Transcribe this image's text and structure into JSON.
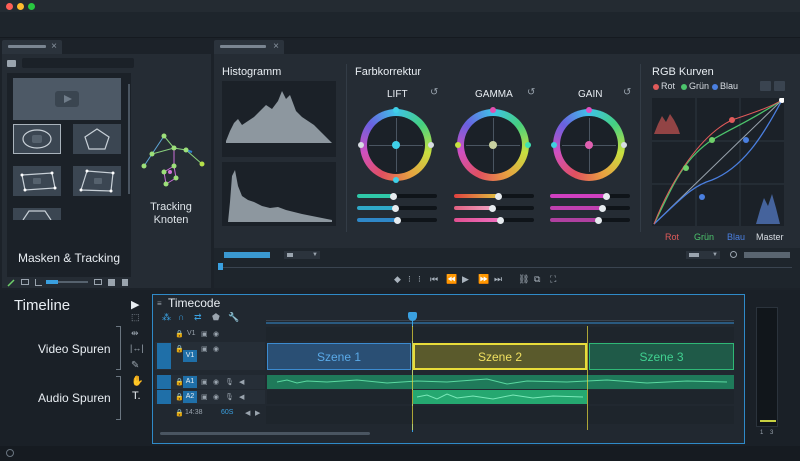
{
  "window": {
    "traffic_lights": [
      "#ff5f57",
      "#febc2e",
      "#28c840"
    ]
  },
  "left_panel": {
    "tab_close": "×",
    "label": "Masken & Tracking"
  },
  "tracking": {
    "label_line1": "Tracking",
    "label_line2": "Knoten"
  },
  "histogram": {
    "title": "Histogramm"
  },
  "color_correction": {
    "title": "Farbkorrektur",
    "wheels": [
      {
        "label": "LIFT",
        "reset_icon": "↺"
      },
      {
        "label": "GAMMA",
        "reset_icon": "↺"
      },
      {
        "label": "GAIN",
        "reset_icon": "↺"
      }
    ]
  },
  "rgb_curves": {
    "title": "RGB Kurven",
    "legend": [
      {
        "label": "Rot",
        "color": "#e05a5a"
      },
      {
        "label": "Grün",
        "color": "#4cc46c"
      },
      {
        "label": "Blau",
        "color": "#4a7fe0"
      }
    ],
    "channels": [
      {
        "label": "Rot",
        "color": "#e05a5a"
      },
      {
        "label": "Grün",
        "color": "#4cc46c"
      },
      {
        "label": "Blau",
        "color": "#4a7fe0"
      },
      {
        "label": "Master",
        "color": "#d8dde3"
      }
    ]
  },
  "timeline": {
    "title": "Timeline",
    "timecode_label": "Timecode",
    "video_label": "Video Spuren",
    "audio_label": "Audio Spuren",
    "tracks": [
      {
        "name": "V1",
        "active": false
      },
      {
        "name": "V1",
        "active": true
      },
      {
        "name": "A1",
        "active": true
      },
      {
        "name": "A2",
        "active": true
      }
    ],
    "timecode_value": "14:38",
    "fps": "60S",
    "clips": [
      {
        "label": "Szene 1",
        "color": "#3c8bd0"
      },
      {
        "label": "Szene 2",
        "color": "#e8dc3a"
      },
      {
        "label": "Szene 3",
        "color": "#2fb876"
      }
    ],
    "meter_labels": [
      "1",
      "3"
    ]
  },
  "colors": {
    "accent_blue": "#3aa0e0",
    "accent_cyan": "#2fd0e0",
    "panel_bg": "#252c34"
  }
}
